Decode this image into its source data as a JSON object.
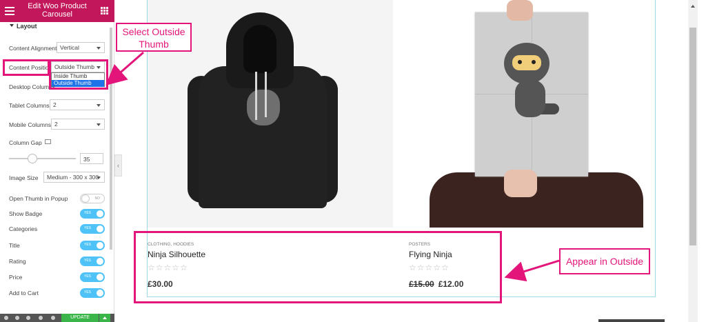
{
  "sidebar": {
    "header_title": "Edit Woo Product Carousel",
    "section_title": "Layout",
    "content_alignment": {
      "label": "Content Alignment",
      "value": "Vertical"
    },
    "content_position": {
      "label": "Content Position",
      "value": "Outside Thumb",
      "options": [
        "Inside Thumb",
        "Outside Thumb"
      ]
    },
    "desktop_columns": {
      "label": "Desktop Columns"
    },
    "tablet_columns": {
      "label": "Tablet Columns",
      "value": "2"
    },
    "mobile_columns": {
      "label": "Mobile Columns",
      "value": "2"
    },
    "column_gap": {
      "label": "Column Gap",
      "value": "35",
      "slider_fraction": 0.35
    },
    "image_size": {
      "label": "Image Size",
      "value": "Medium - 300 x 300"
    },
    "toggles": [
      {
        "label": "Open Thumb in Popup",
        "state": "NO",
        "on": false
      },
      {
        "label": "Show Badge",
        "state": "YES",
        "on": true
      },
      {
        "label": "Categories",
        "state": "YES",
        "on": true
      },
      {
        "label": "Title",
        "state": "YES",
        "on": true
      },
      {
        "label": "Rating",
        "state": "YES",
        "on": true
      },
      {
        "label": "Price",
        "state": "YES",
        "on": true
      },
      {
        "label": "Add to Cart",
        "state": "YES",
        "on": true
      }
    ],
    "update_label": "UPDATE"
  },
  "products": [
    {
      "category": "CLOTHING, HOODIES",
      "title": "Ninja Silhouette",
      "stars": "☆☆☆☆☆",
      "old_price": "",
      "price": "£30.00"
    },
    {
      "category": "POSTERS",
      "title": "Flying Ninja",
      "stars": "☆☆☆☆☆",
      "old_price": "£15.00",
      "price": "£12.00"
    }
  ],
  "annotations": {
    "select_note": "Select Outside Thumb",
    "appear_note": "Appear in Outside"
  },
  "colors": {
    "brand": "#c2185b",
    "highlight": "#e4157a",
    "toggle_on": "#4fc3f7",
    "update": "#39b54a"
  }
}
